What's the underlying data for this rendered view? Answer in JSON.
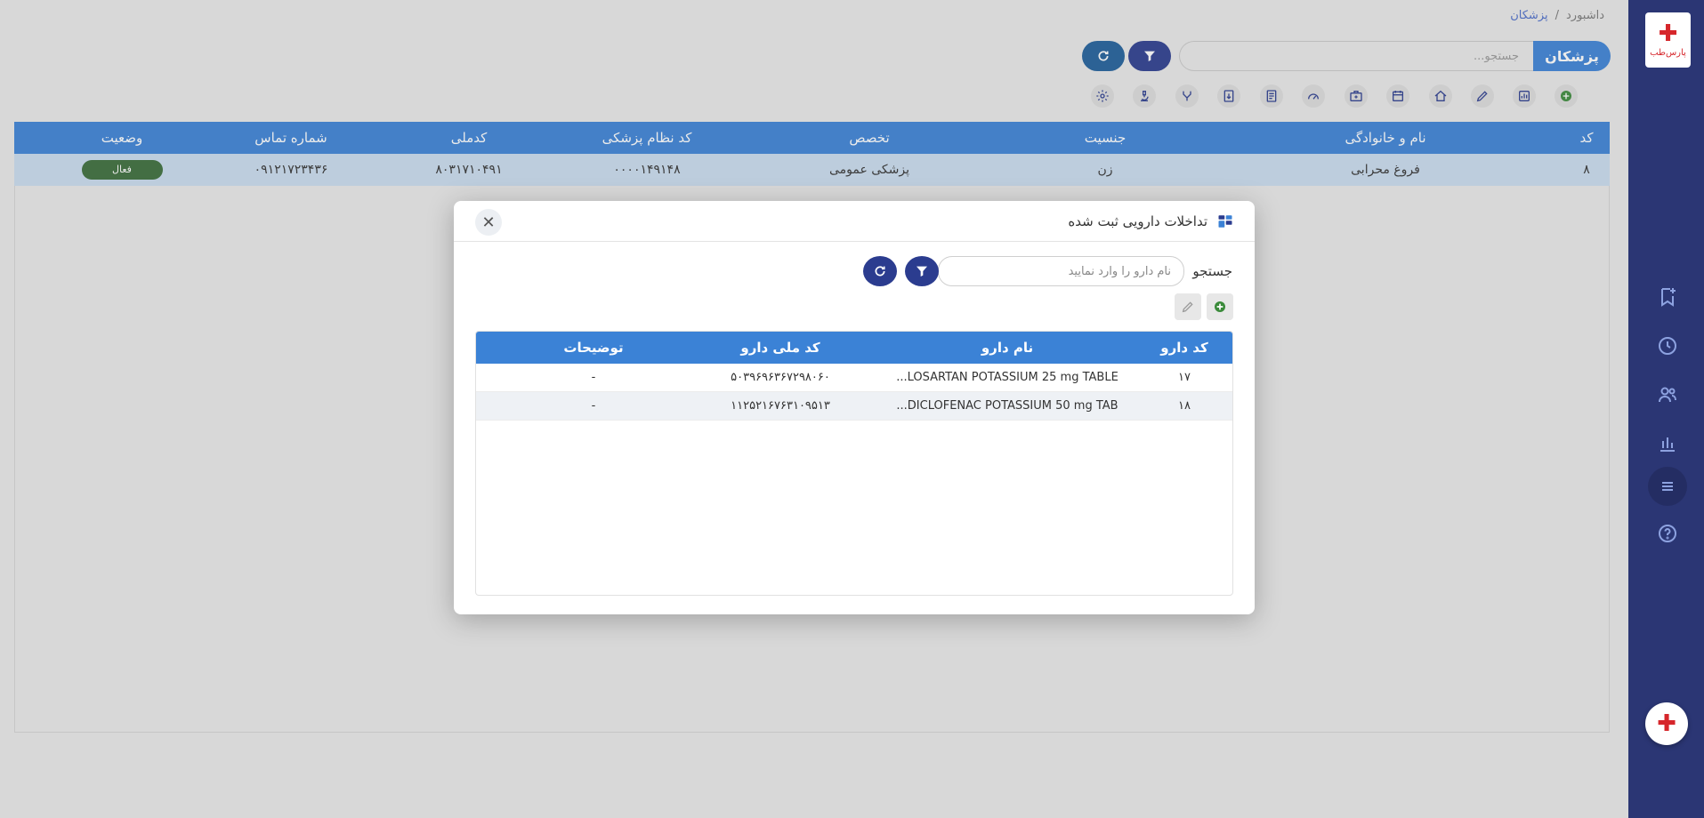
{
  "breadcrumb": {
    "home": "داشبورد",
    "separator": "/",
    "current": "پزشکان"
  },
  "header": {
    "title": "پزشکان",
    "search_placeholder": "جستجو..."
  },
  "logo": {
    "text": "پارس‌طب"
  },
  "table": {
    "columns": [
      "کد",
      "نام و خانوادگی",
      "جنسیت",
      "تخصص",
      "کد نظام پزشکی",
      "کدملی",
      "شماره تماس",
      "وضعیت"
    ],
    "rows": [
      {
        "code": "۸",
        "name": "فروغ محرابی",
        "gender": "زن",
        "specialty": "پزشکی عمومی",
        "medical_code": "۰۰۰۰۱۴۹۱۴۸",
        "national_id": "۸۰۳۱۷۱۰۴۹۱",
        "phone": "۰۹۱۲۱۷۲۳۴۳۶",
        "status": "فعال"
      }
    ]
  },
  "modal": {
    "title": "تداخلات دارویی ثبت شده",
    "search_label": "جستجو",
    "search_placeholder": "نام دارو را وارد نمایید",
    "columns": [
      "کد دارو",
      "نام دارو",
      "کد ملی دارو",
      "توضیحات"
    ],
    "rows": [
      {
        "code": "۱۷",
        "name": "LOSARTAN POTASSIUM 25 mg TABLE...",
        "national_code": "۵۰۳۹۶۹۶۳۶۷۲۹۸۰۶۰",
        "desc": "-"
      },
      {
        "code": "۱۸",
        "name": "DICLOFENAC POTASSIUM 50 mg TAB...",
        "national_code": "۱۱۲۵۲۱۶۷۶۳۱۰۹۵۱۳",
        "desc": "-"
      }
    ]
  },
  "colors": {
    "primary": "#3b82d6",
    "dark_blue": "#2b3c8f",
    "sidebar": "#2b3674",
    "status_active": "#3a6d3a",
    "add_green": "#3a8a3a"
  },
  "icons": {
    "sidebar": [
      "bookmark-add-icon",
      "clock-icon",
      "users-icon",
      "bar-chart-icon",
      "menu-icon",
      "help-icon"
    ],
    "toolbar": [
      "add-icon",
      "report-icon",
      "edit-icon",
      "home-icon",
      "calendar-icon",
      "briefcase-icon",
      "speed-icon",
      "document-icon",
      "archive-icon",
      "split-icon",
      "microscope-icon",
      "settings-icon"
    ]
  }
}
